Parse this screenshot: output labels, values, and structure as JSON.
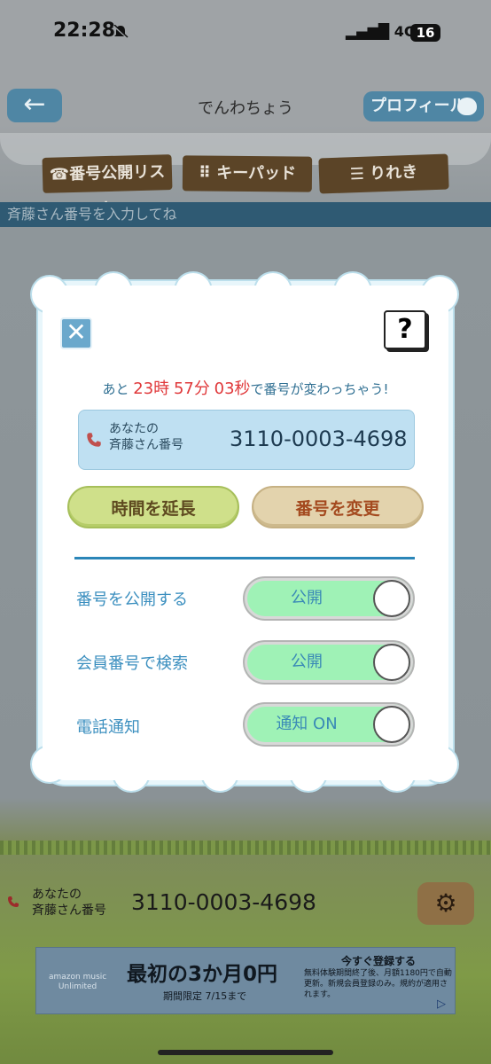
{
  "status_bar": {
    "time": "22:28",
    "network": "4G",
    "battery": "16"
  },
  "nav": {
    "back": "←",
    "title": "でんわちょう",
    "profile": "プロフィール"
  },
  "tabs": [
    {
      "label": "番号公開リスト",
      "icon": "☎"
    },
    {
      "label": "キーパッド",
      "icon": "⠿"
    },
    {
      "label": "りれき",
      "icon": "☰"
    }
  ],
  "hint": "斉藤さん番号を入力してね",
  "modal": {
    "close": "✕",
    "help": "?",
    "countdown": {
      "prefix": "あと",
      "hours": "23",
      "h_unit": "時",
      "minutes": "57",
      "m_unit": "分",
      "seconds": "03",
      "s_unit": "秒",
      "suffix": "で番号が変わっちゃう!"
    },
    "number_label_1": "あなたの",
    "number_label_2": "斉藤さん番号",
    "number": "3110-0003-4698",
    "extend_button": "時間を延長",
    "change_button": "番号を変更",
    "settings": [
      {
        "label": "番号を公開する",
        "toggle": "公開"
      },
      {
        "label": "会員番号で検索",
        "toggle": "公開"
      },
      {
        "label": "電話通知",
        "toggle": "通知 ON"
      }
    ]
  },
  "bottom": {
    "label_1": "あなたの",
    "label_2": "斉藤さん番号",
    "number": "3110-0003-4698"
  },
  "ad": {
    "brand_1": "amazon music",
    "brand_2": "Unlimited",
    "headline": "最初の3か月0円",
    "sub": "期間限定 7/15まで",
    "cta": "今すぐ登録する",
    "small": "無料体験期間終了後、月額1180円で自動更新。新規会員登録のみ。規約が適用されます。"
  },
  "colors": {
    "accent_blue": "#3b8fbf",
    "highlight_red": "#e0383a",
    "toggle_green": "#9ff2b6"
  }
}
